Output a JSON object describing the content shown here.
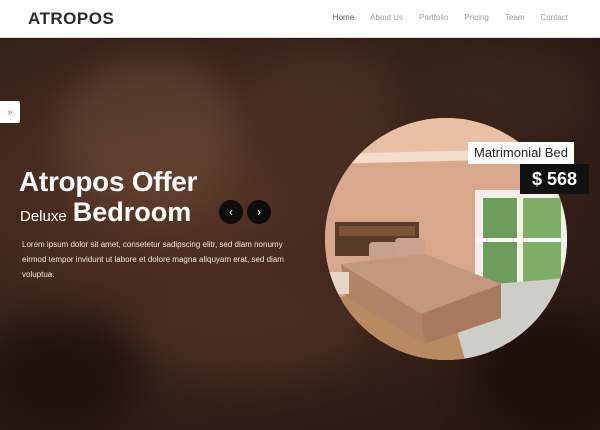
{
  "header": {
    "logo": "ATROPOS",
    "nav": [
      "Home",
      "About Us",
      "Portfolio",
      "Pricing",
      "Team",
      "Contact"
    ]
  },
  "hero": {
    "side_tab_icon": "»",
    "title": "Atropos Offer",
    "subtitle_small": "Deluxe",
    "subtitle_big": "Bedroom",
    "prev_icon": "‹",
    "next_icon": "›",
    "description": "Lorem ipsum dolor sit amet, consetetur sadipscing elitr, sed diam nonumy eirmod tempor invidunt ut labore et dolore magna aliquyam erat, sed diam voluptua."
  },
  "product": {
    "name": "Matrimonial Bed",
    "price": "$ 568"
  },
  "colors": {
    "accent": "#e0623a",
    "hero_bg": "#3a231a",
    "price_bg": "#111111"
  }
}
